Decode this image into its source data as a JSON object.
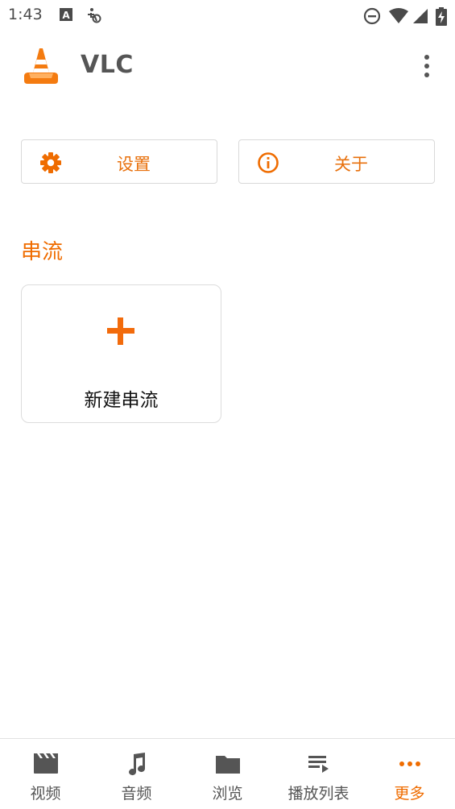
{
  "status_bar": {
    "time": "1:43",
    "left_icons": [
      "a-notification-icon",
      "accessibility-icon"
    ],
    "right_icons": [
      "do-not-disturb-icon",
      "wifi-icon",
      "signal-icon",
      "battery-charging-icon"
    ]
  },
  "app_bar": {
    "title": "VLC",
    "logo_icon": "vlc-cone-icon",
    "overflow_icon": "more-vert-icon"
  },
  "actions": [
    {
      "label": "设置",
      "icon": "gear-icon"
    },
    {
      "label": "关于",
      "icon": "info-icon"
    }
  ],
  "section": {
    "title": "串流",
    "new_stream_label": "新建串流",
    "new_stream_icon": "plus-icon"
  },
  "bottom_nav": {
    "items": [
      {
        "label": "视频",
        "icon": "movie-icon"
      },
      {
        "label": "音频",
        "icon": "music-note-icon"
      },
      {
        "label": "浏览",
        "icon": "folder-icon"
      },
      {
        "label": "播放列表",
        "icon": "playlist-icon"
      },
      {
        "label": "更多",
        "icon": "more-horiz-icon"
      }
    ],
    "active_index": 4
  },
  "colors": {
    "accent": "#ef6c00",
    "text_gray": "#555555",
    "border": "#d9d9d9"
  }
}
